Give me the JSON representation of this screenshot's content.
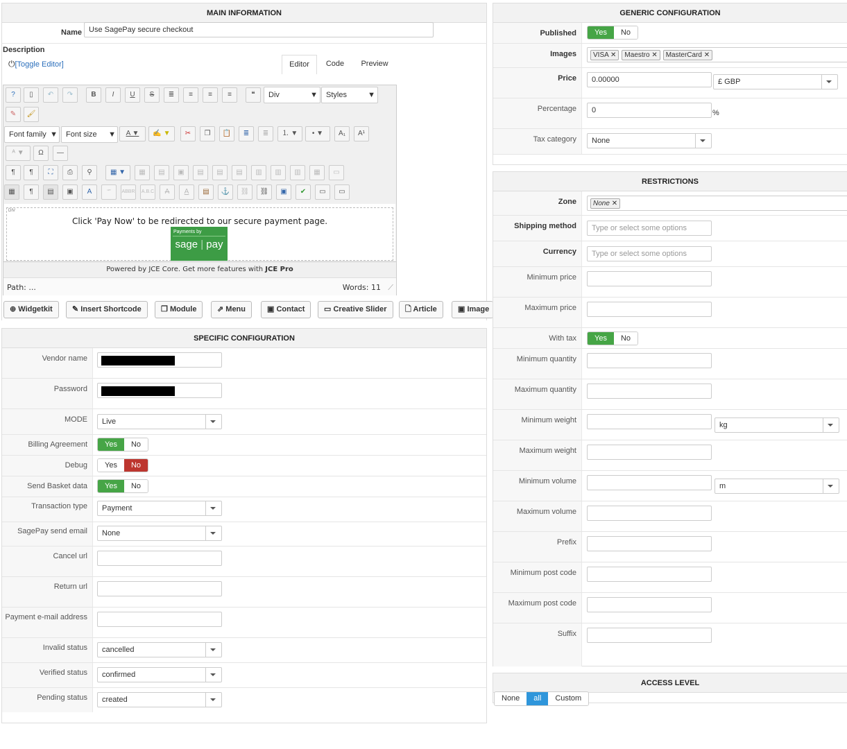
{
  "main": {
    "header": "MAIN INFORMATION",
    "name_label": "Name",
    "name_value": "Use SagePay secure checkout",
    "description_label": "Description",
    "toggle_editor": "[Toggle Editor]",
    "tabs": [
      "Editor",
      "Code",
      "Preview"
    ],
    "block_select": "Div",
    "styles_select": "Styles",
    "font_family": "Font family",
    "font_size": "Font size",
    "content_tag": "DIV",
    "content_text": "Click 'Pay Now' to be redirected to our secure payment page.",
    "logo_top": "Payments by",
    "logo_sage": "sage",
    "logo_pay": "pay",
    "powered_prefix": "Powered by JCE Core. Get more features with ",
    "powered_link": "JCE Pro",
    "path": "Path: ...",
    "words": "Words: 11",
    "buttons": [
      "Widgetkit",
      "Insert Shortcode",
      "Module",
      "Menu",
      "Contact",
      "Creative Slider",
      "Article",
      "Image"
    ]
  },
  "specific": {
    "header": "SPECIFIC CONFIGURATION",
    "vendor_label": "Vendor name",
    "password_label": "Password",
    "mode_label": "MODE",
    "mode_value": "Live",
    "billing_label": "Billing Agreement",
    "debug_label": "Debug",
    "basket_label": "Send Basket data",
    "yes": "Yes",
    "no": "No",
    "transaction_label": "Transaction type",
    "transaction_value": "Payment",
    "sendemail_label": "SagePay send email",
    "sendemail_value": "None",
    "cancel_label": "Cancel url",
    "return_label": "Return url",
    "payemail_label": "Payment e-mail address",
    "invalid_label": "Invalid status",
    "invalid_value": "cancelled",
    "verified_label": "Verified status",
    "verified_value": "confirmed",
    "pending_label": "Pending status",
    "pending_value": "created"
  },
  "generic": {
    "header": "GENERIC CONFIGURATION",
    "published_label": "Published",
    "images_label": "Images",
    "images_tags": [
      "VISA",
      "Maestro",
      "MasterCard"
    ],
    "price_label": "Price",
    "price_value": "0.00000",
    "currency_value": "£ GBP",
    "percentage_label": "Percentage",
    "percentage_value": "0",
    "percent_sign": "%",
    "tax_label": "Tax category",
    "tax_value": "None"
  },
  "restrictions": {
    "header": "RESTRICTIONS",
    "zone_label": "Zone",
    "zone_tag": "None",
    "shipping_label": "Shipping method",
    "shipping_placeholder": "Type or select some options",
    "currency_label": "Currency",
    "currency_placeholder": "Type or select some options",
    "min_price": "Minimum price",
    "max_price": "Maximum price",
    "with_tax": "With tax",
    "min_qty": "Minimum quantity",
    "max_qty": "Maximum quantity",
    "min_weight": "Minimum weight",
    "weight_unit": "kg",
    "max_weight": "Maximum weight",
    "min_volume": "Minimum volume",
    "volume_unit": "m",
    "max_volume": "Maximum volume",
    "prefix": "Prefix",
    "min_post": "Minimum post code",
    "max_post": "Maximum post code",
    "suffix": "Suffix"
  },
  "access": {
    "header": "ACCESS LEVEL",
    "options": [
      "None",
      "all",
      "Custom"
    ]
  },
  "colors": {
    "green": "#46a546",
    "red": "#bd362f",
    "blue": "#2f96db"
  }
}
